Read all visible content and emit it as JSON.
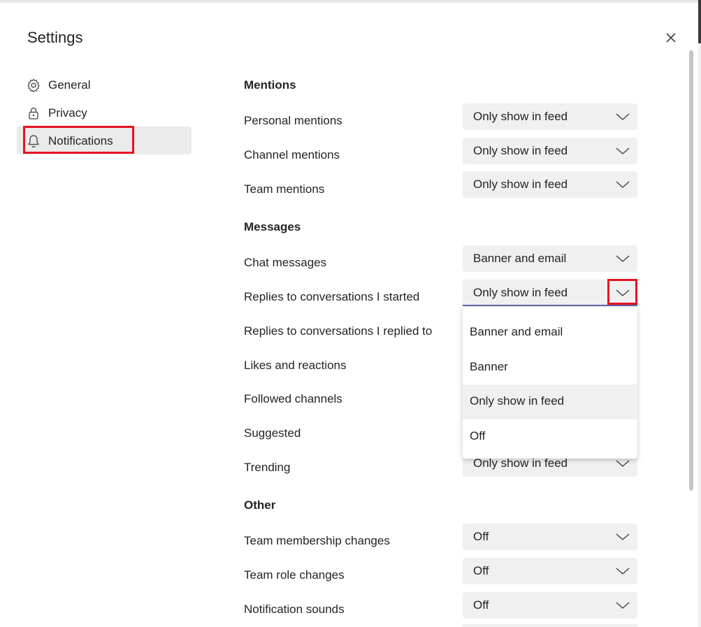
{
  "window": {
    "title": "Settings"
  },
  "nav": {
    "items": [
      {
        "label": "General",
        "icon": "gear-icon"
      },
      {
        "label": "Privacy",
        "icon": "lock-icon"
      },
      {
        "label": "Notifications",
        "icon": "bell-icon",
        "selected": true
      }
    ]
  },
  "sections": {
    "mentions": {
      "title": "Mentions",
      "rows": [
        {
          "label": "Personal mentions",
          "value": "Only show in feed"
        },
        {
          "label": "Channel mentions",
          "value": "Only show in feed"
        },
        {
          "label": "Team mentions",
          "value": "Only show in feed"
        }
      ]
    },
    "messages": {
      "title": "Messages",
      "rows": [
        {
          "label": "Chat messages",
          "value": "Banner and email"
        },
        {
          "label": "Replies to conversations I started",
          "value": "Only show in feed",
          "open": true
        },
        {
          "label": "Replies to conversations I replied to"
        },
        {
          "label": "Likes and reactions"
        },
        {
          "label": "Followed channels"
        },
        {
          "label": "Suggested"
        },
        {
          "label": "Trending",
          "value": "Only show in feed"
        }
      ]
    },
    "other": {
      "title": "Other",
      "rows": [
        {
          "label": "Team membership changes",
          "value": "Off"
        },
        {
          "label": "Team role changes",
          "value": "Off"
        },
        {
          "label": "Notification sounds",
          "value": "Off"
        }
      ]
    }
  },
  "dropdown_menu": {
    "options": [
      "Banner and email",
      "Banner",
      "Only show in feed",
      "Off"
    ],
    "selected": "Only show in feed"
  },
  "colors": {
    "highlight": "#e81123",
    "accent": "#6264a7",
    "control_bg": "#f0f0f0"
  }
}
